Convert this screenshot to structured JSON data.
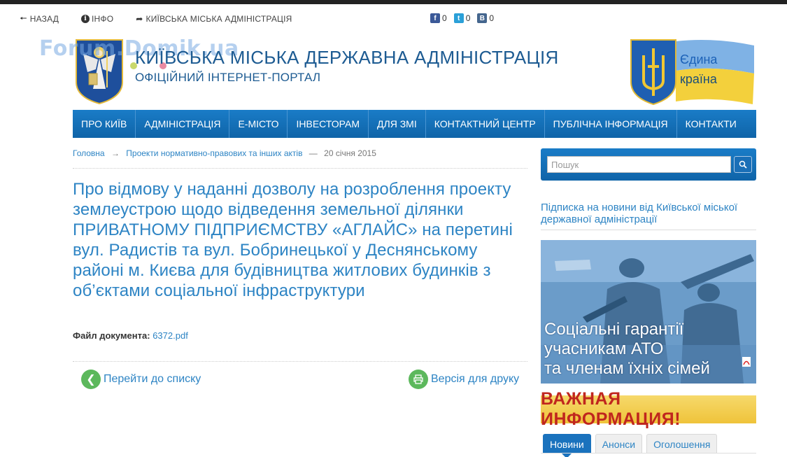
{
  "utility": {
    "back": "НАЗАД",
    "info": "ІНФО",
    "city_admin": "КИЇВСЬКА МІСЬКА АДМІНІСТРАЦІЯ"
  },
  "social": {
    "facebook_count": "0",
    "twitter_count": "0",
    "vk_count": "0"
  },
  "watermark": "Forum.Domik.ua",
  "header": {
    "title": "КИЇВСЬКА МІСЬКА ДЕРЖАВНА АДМІНІСТРАЦІЯ",
    "subtitle": "ОФІЦІЙНИЙ ІНТЕРНЕТ-ПОРТАЛ"
  },
  "banner": {
    "line1": "Єдина",
    "line2": "країна"
  },
  "nav": [
    "ПРО КИЇВ",
    "АДМІНІСТРАЦІЯ",
    "Е-МІСТО",
    "ІНВЕСТОРАМ",
    "ДЛЯ ЗМІ",
    "КОНТАКТНИЙ ЦЕНТР",
    "ПУБЛІЧНА ІНФОРМАЦІЯ",
    "КОНТАКТИ"
  ],
  "breadcrumb": {
    "home": "Головна",
    "separator": "→",
    "section": "Проекти нормативно-правових та інших актів",
    "dash": "—",
    "date": "20 січня 2015"
  },
  "article": {
    "title": "Про відмову у наданні дозволу на розроблення проекту землеустрою щодо відведення земельної ділянки ПРИВАТНОМУ ПІДПРИЄМСТВУ «АГЛАЙС» на перетині вул. Радистів та вул. Бобринецької у Деснянському районі м. Києва для будівництва житлових будинків з об’єктами соціальної інфраструктури",
    "file_label": "Файл документа:",
    "file_name": "6372.pdf",
    "back_to_list": "Перейти до списку",
    "print_version": "Версія для друку"
  },
  "sidebar": {
    "search_placeholder": "Пошук",
    "subscribe": "Підписка на новини від Київської міської державної адміністрації",
    "promo_line1": "Соціальні гарантії",
    "promo_line2": "учасникам АТО",
    "promo_line3": "та членам їхніх сімей",
    "important": "ВАЖНАЯ ИНФОРМАЦИЯ!",
    "tabs": [
      "Новини",
      "Анонси",
      "Оголошення"
    ]
  },
  "colors": {
    "nav_blue": "#1a7cc7",
    "link_blue": "#2d84c4",
    "action_green": "#5cb85c",
    "important_red": "#c0261e",
    "important_yellow": "#f1c842"
  }
}
